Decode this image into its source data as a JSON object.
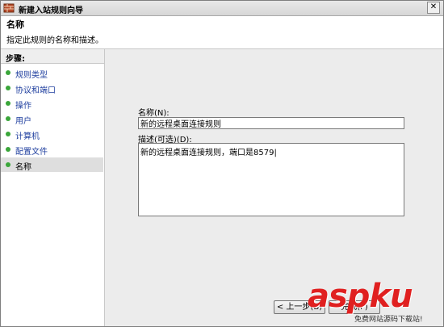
{
  "window": {
    "title": "新建入站规则向导",
    "close_label": "✕"
  },
  "header": {
    "title": "名称",
    "description": "指定此规则的名称和描述。"
  },
  "sidebar": {
    "steps_title": "步骤:",
    "items": [
      {
        "label": "规则类型",
        "current": false
      },
      {
        "label": "协议和端口",
        "current": false
      },
      {
        "label": "操作",
        "current": false
      },
      {
        "label": "用户",
        "current": false
      },
      {
        "label": "计算机",
        "current": false
      },
      {
        "label": "配置文件",
        "current": false
      },
      {
        "label": "名称",
        "current": true
      }
    ]
  },
  "form": {
    "name_label": "名称(N):",
    "name_value": "新的远程桌面连接规则",
    "description_label": "描述(可选)(D):",
    "description_value": "新的远程桌面连接规则，端口是8579|"
  },
  "buttons": {
    "back_label": "< 上一步(B)",
    "finish_label": "完成(F)"
  },
  "watermark": {
    "brand": "aspku",
    "tagline": "免费网站源码下载站!"
  },
  "colors": {
    "step_dot": "#3aa63a",
    "step_link": "#1f3f9f",
    "watermark": "#e02020"
  }
}
